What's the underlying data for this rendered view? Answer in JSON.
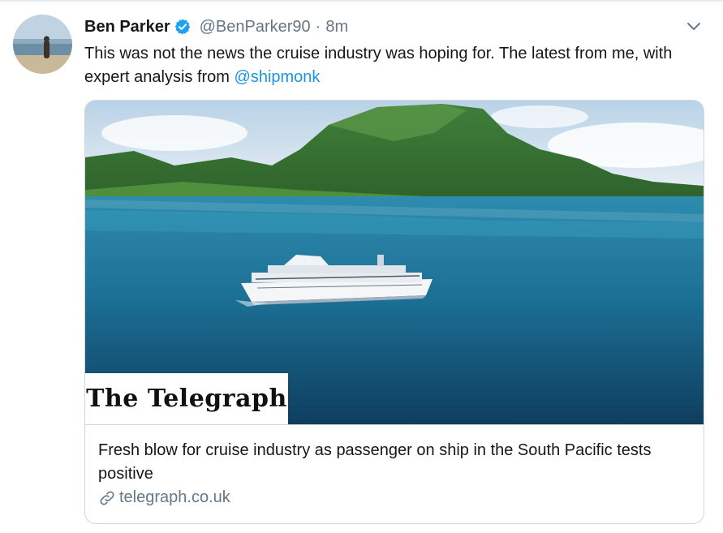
{
  "tweet": {
    "author_name": "Ben Parker",
    "handle": "@BenParker90",
    "separator": "·",
    "time": "8m",
    "text_main": "This was not the news the cruise industry was hoping for. The latest from me, with expert analysis from ",
    "mention": "@shipmonk"
  },
  "card": {
    "publisher_logo": "The Telegraph",
    "title": "Fresh blow for cruise industry as passenger on ship in the South Pacific tests positive",
    "domain": "telegraph.co.uk"
  },
  "icons": {
    "verified": "verified-badge-icon",
    "more": "chevron-down-icon",
    "link": "link-icon"
  },
  "colors": {
    "link_blue": "#1b95e0",
    "verified_blue": "#1da1f2",
    "secondary_text": "#657786"
  }
}
